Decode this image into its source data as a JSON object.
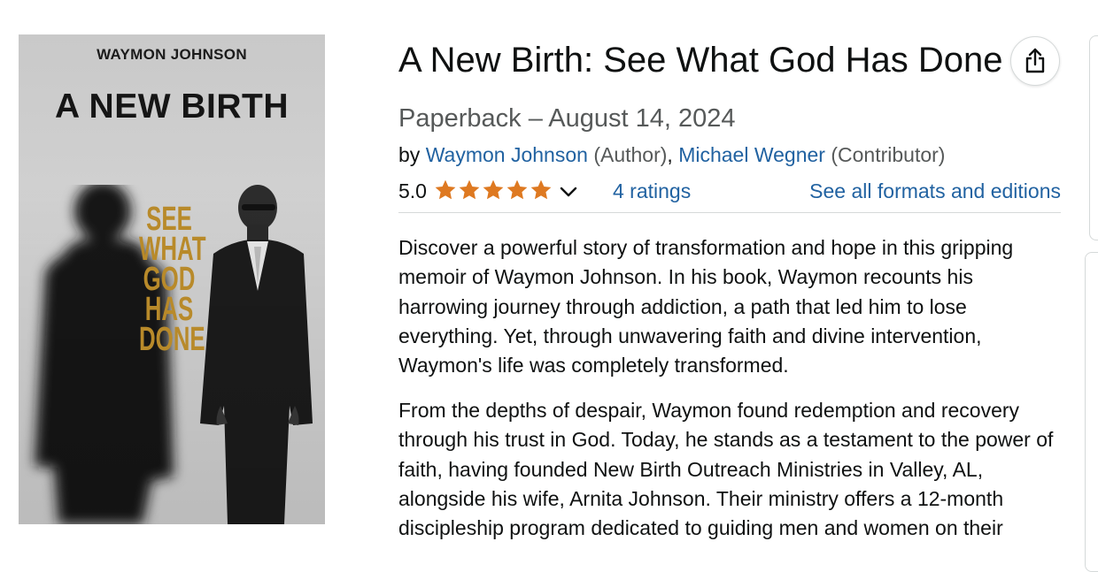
{
  "cover": {
    "author": "WAYMON JOHNSON",
    "title": "A NEW BIRTH",
    "subtitle_lines": [
      "SEE",
      "WHAT",
      "GOD",
      "HAS",
      "DONE"
    ]
  },
  "product": {
    "title": "A New Birth: See What God Has Done",
    "edition": "Paperback – August 14, 2024",
    "byline": {
      "by": "by",
      "contributors": [
        {
          "name": "Waymon Johnson",
          "role": "(Author)",
          "separator": ", "
        },
        {
          "name": "Michael Wegner",
          "role": "(Contributor)",
          "separator": ""
        }
      ]
    }
  },
  "rating": {
    "value": "5.0",
    "stars": 5,
    "ratings_count_label": "4 ratings",
    "formats_link": "See all formats and editions"
  },
  "description": {
    "paragraphs": [
      "Discover a powerful story of transformation and hope in this gripping memoir of Waymon Johnson. In his book, Waymon recounts his harrowing journey through addiction, a path that led him to lose everything. Yet, through unwavering faith and divine intervention, Waymon's life was completely transformed.",
      "From the depths of despair, Waymon found redemption and recovery through his trust in God. Today, he stands as a testament to the power of faith, having founded New Birth Outreach Ministries in Valley, AL, alongside his wife, Arnita Johnson. Their ministry offers a 12-month discipleship program dedicated to guiding men and women on their"
    ]
  },
  "colors": {
    "link": "#2162a1",
    "star": "#de7921",
    "secondary_text": "#565959",
    "cover_gold": "#b88a2a"
  },
  "icons": {
    "share": "share-icon",
    "star": "star-icon",
    "chevron": "chevron-down-icon"
  }
}
